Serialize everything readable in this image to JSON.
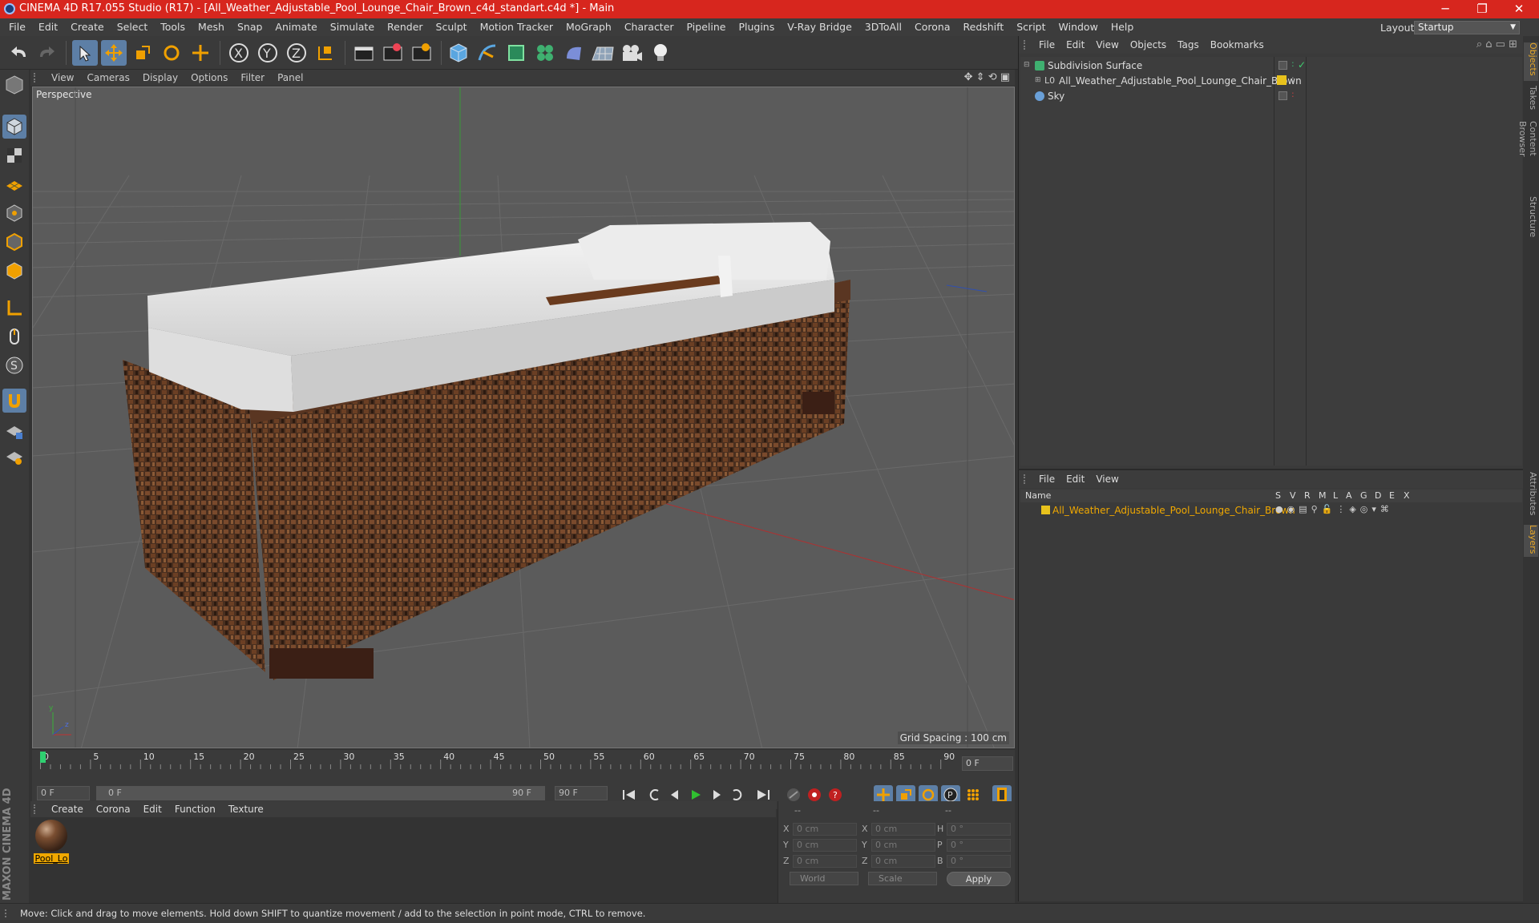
{
  "window": {
    "title": "CINEMA 4D R17.055 Studio (R17) - [All_Weather_Adjustable_Pool_Lounge_Chair_Brown_c4d_standart.c4d *] - Main",
    "minimize": "─",
    "maximize": "❐",
    "close": "✕"
  },
  "menubar": {
    "items": [
      "File",
      "Edit",
      "Create",
      "Select",
      "Tools",
      "Mesh",
      "Snap",
      "Animate",
      "Simulate",
      "Render",
      "Sculpt",
      "Motion Tracker",
      "MoGraph",
      "Character",
      "Pipeline",
      "Plugins",
      "V-Ray Bridge",
      "3DToAll",
      "Corona",
      "Redshift",
      "Script",
      "Window",
      "Help"
    ],
    "layout_label": "Layout:",
    "layout_value": "Startup"
  },
  "viewport": {
    "menu": [
      "View",
      "Cameras",
      "Display",
      "Options",
      "Filter",
      "Panel"
    ],
    "label": "Perspective",
    "grid_spacing": "Grid Spacing : 100 cm"
  },
  "timeline": {
    "ticks": [
      "0",
      "5",
      "10",
      "15",
      "20",
      "25",
      "30",
      "35",
      "40",
      "45",
      "50",
      "55",
      "60",
      "65",
      "70",
      "75",
      "80",
      "85",
      "90"
    ],
    "current_frame": "0 F",
    "start_field": "0 F",
    "range_start": "0 F",
    "range_end": "90 F",
    "end_field": "90 F"
  },
  "material_manager": {
    "menu": [
      "Create",
      "Corona",
      "Edit",
      "Function",
      "Texture"
    ],
    "materials": [
      {
        "name": "Pool_Lo"
      }
    ]
  },
  "coordinates": {
    "headers": [
      "--",
      "--",
      "--"
    ],
    "rows": [
      {
        "a": "X",
        "av": "0 cm",
        "b": "X",
        "bv": "0 cm",
        "c": "H",
        "cv": "0 °"
      },
      {
        "a": "Y",
        "av": "0 cm",
        "b": "Y",
        "bv": "0 cm",
        "c": "P",
        "cv": "0 °"
      },
      {
        "a": "Z",
        "av": "0 cm",
        "b": "Z",
        "bv": "0 cm",
        "c": "B",
        "cv": "0 °"
      }
    ],
    "space": "World",
    "mode": "Scale",
    "apply": "Apply"
  },
  "object_manager": {
    "menu": [
      "File",
      "Edit",
      "View",
      "Objects",
      "Tags",
      "Bookmarks"
    ],
    "objects": [
      {
        "name": "Subdivision Surface"
      },
      {
        "name": "All_Weather_Adjustable_Pool_Lounge_Chair_Brown"
      },
      {
        "name": "Sky"
      }
    ]
  },
  "layer_manager": {
    "menu": [
      "File",
      "Edit",
      "View"
    ],
    "columns": [
      "Name",
      "S",
      "V",
      "R",
      "M",
      "L",
      "A",
      "G",
      "D",
      "E",
      "X"
    ],
    "layers": [
      {
        "name": "All_Weather_Adjustable_Pool_Lounge_Chair_Brown",
        "color": "#e8c21c"
      }
    ]
  },
  "side_tabs": [
    "Objects",
    "Takes",
    "Content Browser",
    "Structure",
    "Attributes",
    "Layers"
  ],
  "status": "Move: Click and drag to move elements. Hold down SHIFT to quantize movement / add to the selection in point mode, CTRL to remove.",
  "branding": "MAXON CINEMA 4D",
  "colors": {
    "accent": "#5d7fa6",
    "title_bar": "#d7261e",
    "highlight": "#f0a800"
  }
}
